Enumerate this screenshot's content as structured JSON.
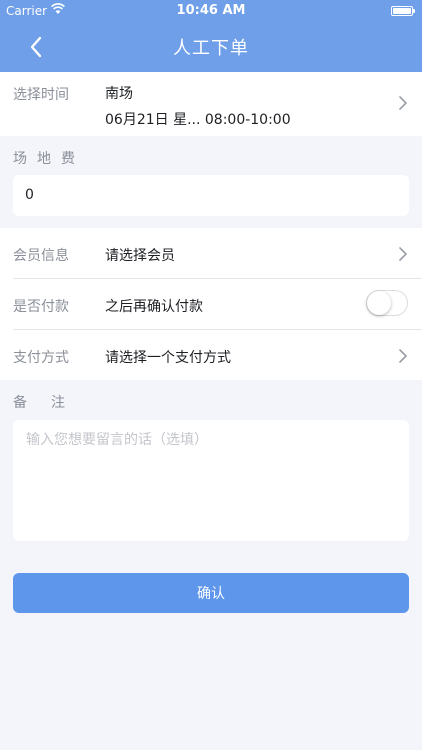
{
  "colors": {
    "nav_bg": "#6f9fe8",
    "button_bg": "#5e96ec",
    "page_bg": "#f4f5fb"
  },
  "status_bar": {
    "carrier": "Carrier",
    "time": "10:46 AM"
  },
  "nav": {
    "title": "人工下单",
    "back_icon": "chevron-left-icon"
  },
  "time_select": {
    "label": "选择时间",
    "venue": "南场",
    "datetime": "06月21日 星... 08:00-10:00"
  },
  "fee": {
    "label": "场地费",
    "value": "0"
  },
  "member": {
    "label": "会员信息",
    "value": "请选择会员"
  },
  "payment_status": {
    "label": "是否付款",
    "value": "之后再确认付款",
    "toggle_on": false
  },
  "payment_method": {
    "label": "支付方式",
    "value": "请选择一个支付方式"
  },
  "note": {
    "label": "备注",
    "placeholder": "输入您想要留言的话（选填）"
  },
  "confirm_button": {
    "label": "确认"
  }
}
